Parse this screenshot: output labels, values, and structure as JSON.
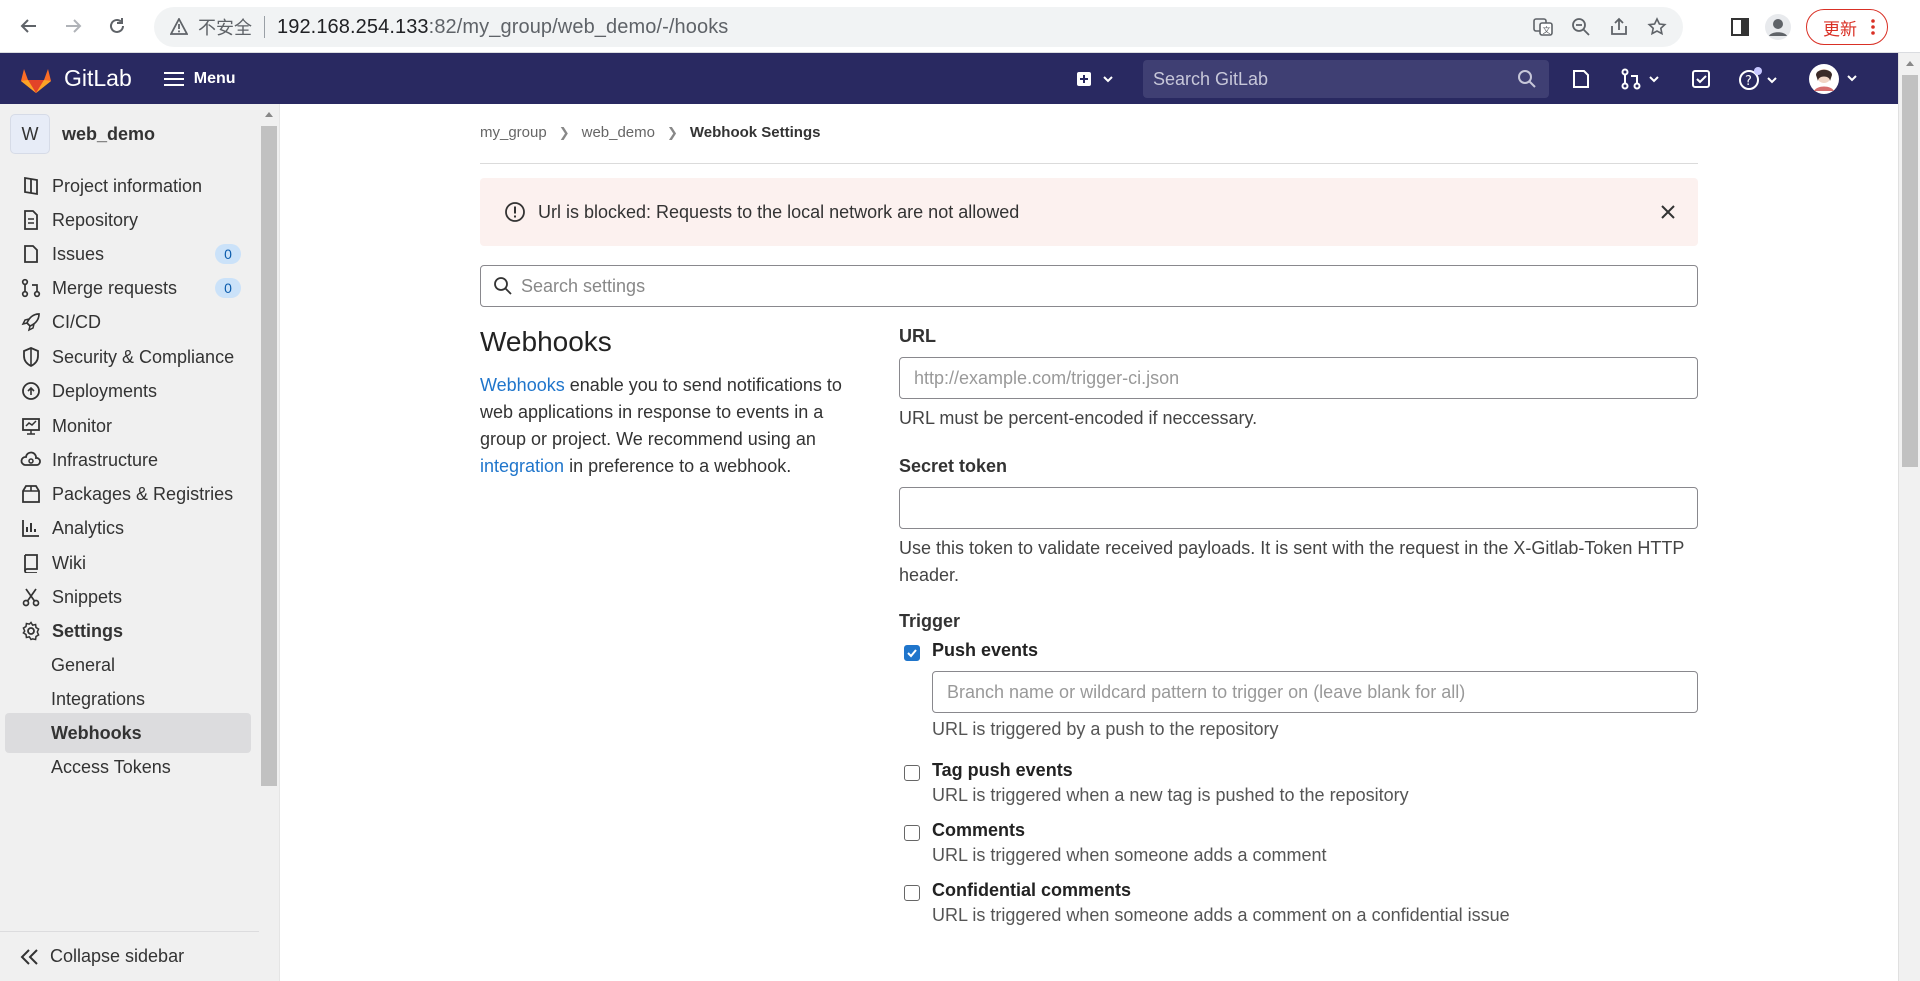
{
  "browser": {
    "insecure_label": "不安全",
    "url_host": "192.168.254.133",
    "url_rest": ":82/my_group/web_demo/-/hooks",
    "update_label": "更新"
  },
  "header": {
    "brand": "GitLab",
    "menu_label": "Menu",
    "search_placeholder": "Search GitLab"
  },
  "sidebar": {
    "project_initial": "W",
    "project_name": "web_demo",
    "items": [
      {
        "label": "Project information",
        "icon": "info-doc-icon"
      },
      {
        "label": "Repository",
        "icon": "document-icon"
      },
      {
        "label": "Issues",
        "icon": "issues-icon",
        "badge": "0"
      },
      {
        "label": "Merge requests",
        "icon": "merge-request-icon",
        "badge": "0"
      },
      {
        "label": "CI/CD",
        "icon": "rocket-icon"
      },
      {
        "label": "Security & Compliance",
        "icon": "shield-icon"
      },
      {
        "label": "Deployments",
        "icon": "deployments-icon"
      },
      {
        "label": "Monitor",
        "icon": "monitor-icon"
      },
      {
        "label": "Infrastructure",
        "icon": "cloud-gear-icon"
      },
      {
        "label": "Packages & Registries",
        "icon": "package-icon"
      },
      {
        "label": "Analytics",
        "icon": "chart-icon"
      },
      {
        "label": "Wiki",
        "icon": "book-icon"
      },
      {
        "label": "Snippets",
        "icon": "scissors-icon"
      },
      {
        "label": "Settings",
        "icon": "gear-icon"
      }
    ],
    "settings_sub": [
      "General",
      "Integrations",
      "Webhooks",
      "Access Tokens"
    ],
    "collapse_label": "Collapse sidebar"
  },
  "breadcrumb": [
    "my_group",
    "web_demo",
    "Webhook Settings"
  ],
  "alert": {
    "message": "Url is blocked: Requests to the local network are not allowed"
  },
  "settings_search": {
    "placeholder": "Search settings"
  },
  "webhooks": {
    "title": "Webhooks",
    "desc_link1": "Webhooks",
    "desc_part1": " enable you to send notifications to web applications in response to events in a group or project. We recommend using an ",
    "desc_link2": "integration",
    "desc_part2": " in preference to a webhook."
  },
  "form": {
    "url_label": "URL",
    "url_placeholder": "http://example.com/trigger-ci.json",
    "url_help": "URL must be percent-encoded if neccessary.",
    "secret_label": "Secret token",
    "secret_value": "",
    "secret_help": "Use this token to validate received payloads. It is sent with the request in the X-Gitlab-Token HTTP header.",
    "trigger_label": "Trigger",
    "branch_placeholder": "Branch name or wildcard pattern to trigger on (leave blank for all)",
    "triggers": [
      {
        "title": "Push events",
        "desc": "URL is triggered by a push to the repository",
        "checked": true
      },
      {
        "title": "Tag push events",
        "desc": "URL is triggered when a new tag is pushed to the repository",
        "checked": false
      },
      {
        "title": "Comments",
        "desc": "URL is triggered when someone adds a comment",
        "checked": false
      },
      {
        "title": "Confidential comments",
        "desc": "URL is triggered when someone adds a comment on a confidential issue",
        "checked": false
      }
    ]
  },
  "colors": {
    "header_bg": "#292961",
    "link": "#1f75cb",
    "alert_bg": "#fcf1ef",
    "checkbox_checked": "#1f75cb"
  }
}
